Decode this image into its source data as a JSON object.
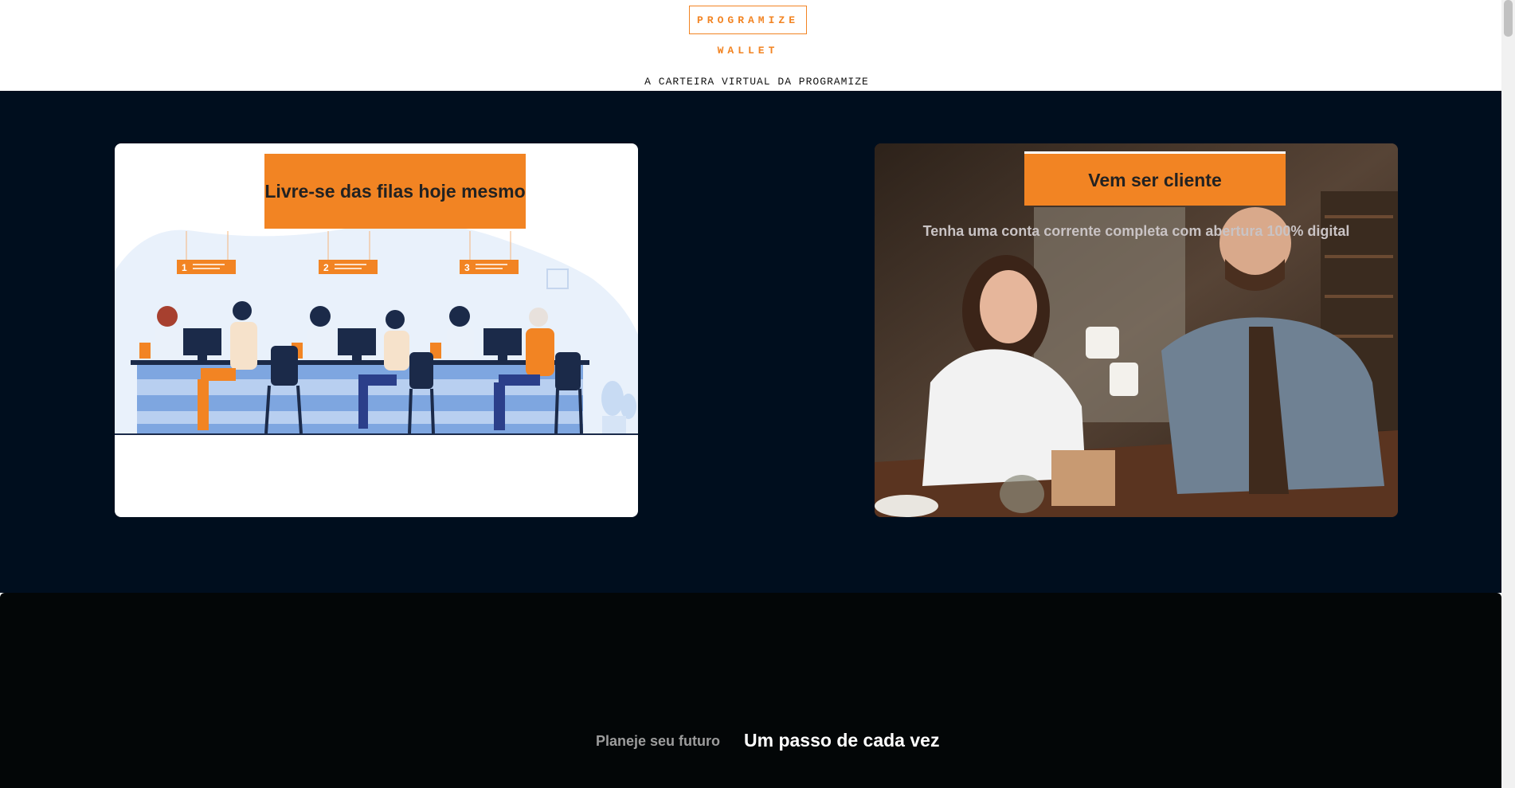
{
  "header": {
    "logo_text": "PROGRAMIZE",
    "logo_sub": "WALLET",
    "tagline": "A CARTEIRA VIRTUAL DA PROGRAMIZE"
  },
  "cards": [
    {
      "title": "Livre-se das filas hoje mesmo",
      "illustration_numbers": [
        "1",
        "2",
        "3"
      ]
    },
    {
      "title": "Vem ser cliente",
      "text": "Tenha uma conta corrente completa com abertura 100% digital"
    }
  ],
  "footer": {
    "text_a": "Planeje seu futuro",
    "text_b": "Um passo de cada vez"
  },
  "colors": {
    "accent": "#f28423",
    "hero_bg": "#000e1e",
    "footer_bg": "#030607"
  }
}
